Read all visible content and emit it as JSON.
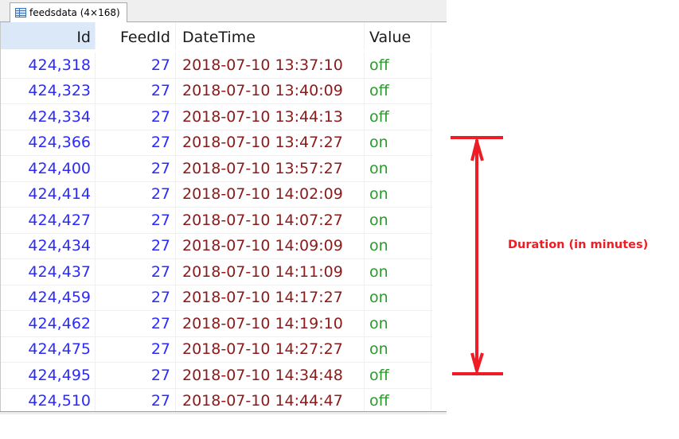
{
  "tab": {
    "icon": "table-icon",
    "title": "feedsdata (4×168)"
  },
  "columns": [
    "Id",
    "FeedId",
    "DateTime",
    "Value"
  ],
  "rows": [
    {
      "id": "424,318",
      "feed": "27",
      "dt": "2018-07-10 13:37:10",
      "val": "off"
    },
    {
      "id": "424,323",
      "feed": "27",
      "dt": "2018-07-10 13:40:09",
      "val": "off"
    },
    {
      "id": "424,334",
      "feed": "27",
      "dt": "2018-07-10 13:44:13",
      "val": "off"
    },
    {
      "id": "424,366",
      "feed": "27",
      "dt": "2018-07-10 13:47:27",
      "val": "on"
    },
    {
      "id": "424,400",
      "feed": "27",
      "dt": "2018-07-10 13:57:27",
      "val": "on"
    },
    {
      "id": "424,414",
      "feed": "27",
      "dt": "2018-07-10 14:02:09",
      "val": "on"
    },
    {
      "id": "424,427",
      "feed": "27",
      "dt": "2018-07-10 14:07:27",
      "val": "on"
    },
    {
      "id": "424,434",
      "feed": "27",
      "dt": "2018-07-10 14:09:09",
      "val": "on"
    },
    {
      "id": "424,437",
      "feed": "27",
      "dt": "2018-07-10 14:11:09",
      "val": "on"
    },
    {
      "id": "424,459",
      "feed": "27",
      "dt": "2018-07-10 14:17:27",
      "val": "on"
    },
    {
      "id": "424,462",
      "feed": "27",
      "dt": "2018-07-10 14:19:10",
      "val": "on"
    },
    {
      "id": "424,475",
      "feed": "27",
      "dt": "2018-07-10 14:27:27",
      "val": "on"
    },
    {
      "id": "424,495",
      "feed": "27",
      "dt": "2018-07-10 14:34:48",
      "val": "off"
    },
    {
      "id": "424,510",
      "feed": "27",
      "dt": "2018-07-10 14:44:47",
      "val": "off"
    }
  ],
  "annotation": {
    "label": "Duration (in minutes)",
    "color": "#ee1c24"
  },
  "colors": {
    "id": "#2a2aff",
    "datetime": "#8b1a1a",
    "value": "#2a9a2a",
    "header_selected": "#dbe8f8"
  }
}
